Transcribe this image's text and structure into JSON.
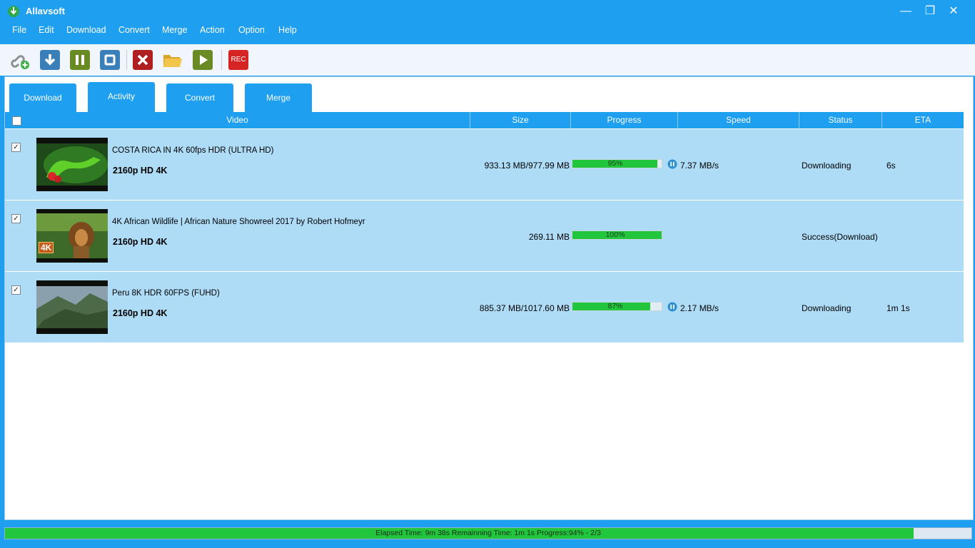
{
  "app": {
    "title": "Allavsoft"
  },
  "window_controls": {
    "minimize": "—",
    "restore": "❐",
    "close": "✕"
  },
  "menu": [
    "File",
    "Edit",
    "Download",
    "Convert",
    "Merge",
    "Action",
    "Option",
    "Help"
  ],
  "toolbar": {
    "rec_label": "REC"
  },
  "tabs": [
    {
      "label": "Download"
    },
    {
      "label": "Activity"
    },
    {
      "label": "Convert"
    },
    {
      "label": "Merge"
    }
  ],
  "columns": [
    "Video",
    "Size",
    "Progress",
    "Speed",
    "Status",
    "ETA"
  ],
  "rows": [
    {
      "title": "COSTA RICA IN 4K 60fps HDR (ULTRA HD)",
      "quality": "2160p HD 4K",
      "size": "933.13 MB/977.99 MB",
      "progress_text": "95%",
      "progress": 95,
      "speed": "7.37 MB/s",
      "status": "Downloading",
      "eta": "6s",
      "checked": "✓"
    },
    {
      "title": "4K African Wildlife | African Nature Showreel 2017 by Robert Hofmeyr",
      "quality": "2160p HD 4K",
      "size": "269.11 MB",
      "progress_text": "100%",
      "progress": 100,
      "speed": "",
      "status": "Success(Download)",
      "eta": "",
      "checked": "✓",
      "thumb_badge": "4K"
    },
    {
      "title": "Peru 8K HDR 60FPS (FUHD)",
      "quality": "2160p HD 4K",
      "size": "885.37 MB/1017.60 MB",
      "progress_text": "87%",
      "progress": 87,
      "speed": "2.17 MB/s",
      "status": "Downloading",
      "eta": "1m  1s",
      "checked": "✓"
    }
  ],
  "status_bar": {
    "text": "Elapsed Time: 9m 38s Remainning Time: 1m  1s Progress:94% - 2/3",
    "progress": 94
  },
  "colors": {
    "accent": "#1e9ff0",
    "row_bg": "#aedcf7",
    "progress": "#22c63c"
  }
}
